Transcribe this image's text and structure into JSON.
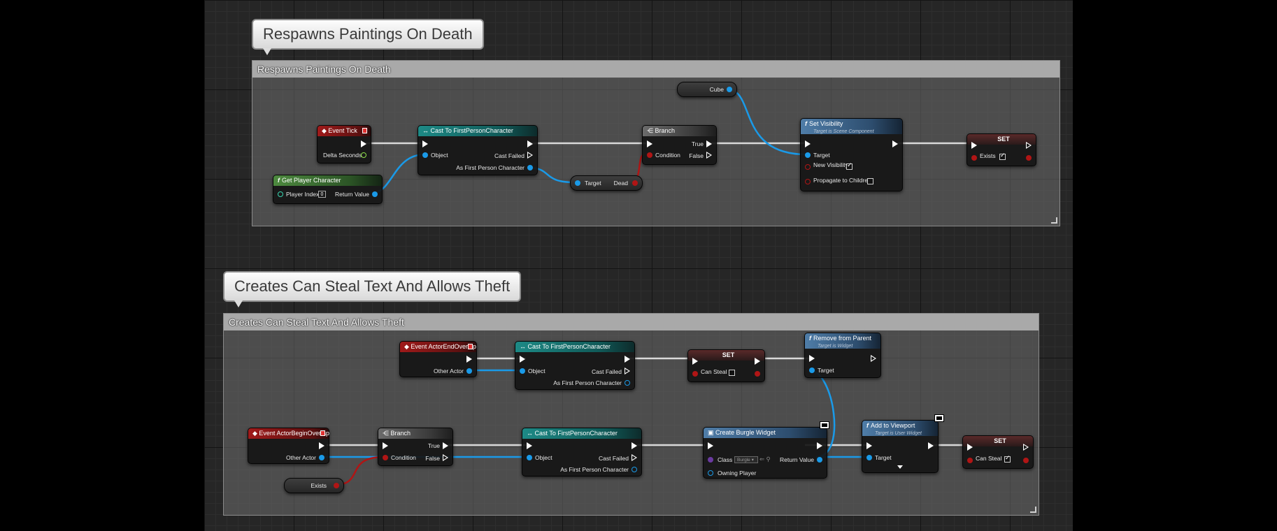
{
  "comments": [
    {
      "bubble": "Respawns Paintings On Death",
      "header": "Respawns Paintings On Death"
    },
    {
      "bubble": "Creates Can Steal Text And Allows Theft",
      "header": "Creates Can Steal Text And Allows Theft"
    }
  ],
  "colors": {
    "exec": "#ffffff",
    "object": "#1a9ae8",
    "boolean": "#b01515",
    "float": "#8ee04a",
    "integer": "#38d6b0",
    "class": "#6a3aa0"
  },
  "g1": {
    "event_tick": {
      "title": "Event Tick",
      "delta": "Delta Seconds"
    },
    "get_player": {
      "title": "Get Player Character",
      "index_label": "Player Index",
      "index_value": "0",
      "ret": "Return Value"
    },
    "cast": {
      "title": "Cast To FirstPersonCharacter",
      "object": "Object",
      "failed": "Cast Failed",
      "as": "As First Person Character"
    },
    "target_dead": {
      "target": "Target",
      "dead": "Dead"
    },
    "branch": {
      "title": "Branch",
      "condition": "Condition",
      "true": "True",
      "false": "False"
    },
    "cube": {
      "label": "Cube"
    },
    "set_vis": {
      "title": "Set Visibility",
      "subtitle": "Target is Scene Component",
      "target": "Target",
      "new_vis": "New Visibility",
      "propagate": "Propagate to Children"
    },
    "set": {
      "title": "SET",
      "var": "Exists"
    }
  },
  "g2": {
    "end_overlap": {
      "title": "Event ActorEndOverlap",
      "other": "Other Actor"
    },
    "cast_a": {
      "title": "Cast To FirstPersonCharacter",
      "object": "Object",
      "failed": "Cast Failed",
      "as": "As First Person Character"
    },
    "set_a": {
      "title": "SET",
      "var": "Can Steal"
    },
    "remove": {
      "title": "Remove from Parent",
      "subtitle": "Target is Widget",
      "target": "Target"
    },
    "begin_overlap": {
      "title": "Event ActorBeginOverlap",
      "other": "Other Actor"
    },
    "branch": {
      "title": "Branch",
      "condition": "Condition",
      "true": "True",
      "false": "False"
    },
    "cast_b": {
      "title": "Cast To FirstPersonCharacter",
      "object": "Object",
      "failed": "Cast Failed",
      "as": "As First Person Character"
    },
    "create": {
      "title": "Create Burgle Widget",
      "class": "Class",
      "class_value": "Burgle",
      "ret": "Return Value",
      "owner": "Owning Player"
    },
    "add_vp": {
      "title": "Add to Viewport",
      "subtitle": "Target is User Widget",
      "target": "Target"
    },
    "set_b": {
      "title": "SET",
      "var": "Can Steal"
    },
    "exists": {
      "label": "Exists"
    }
  }
}
